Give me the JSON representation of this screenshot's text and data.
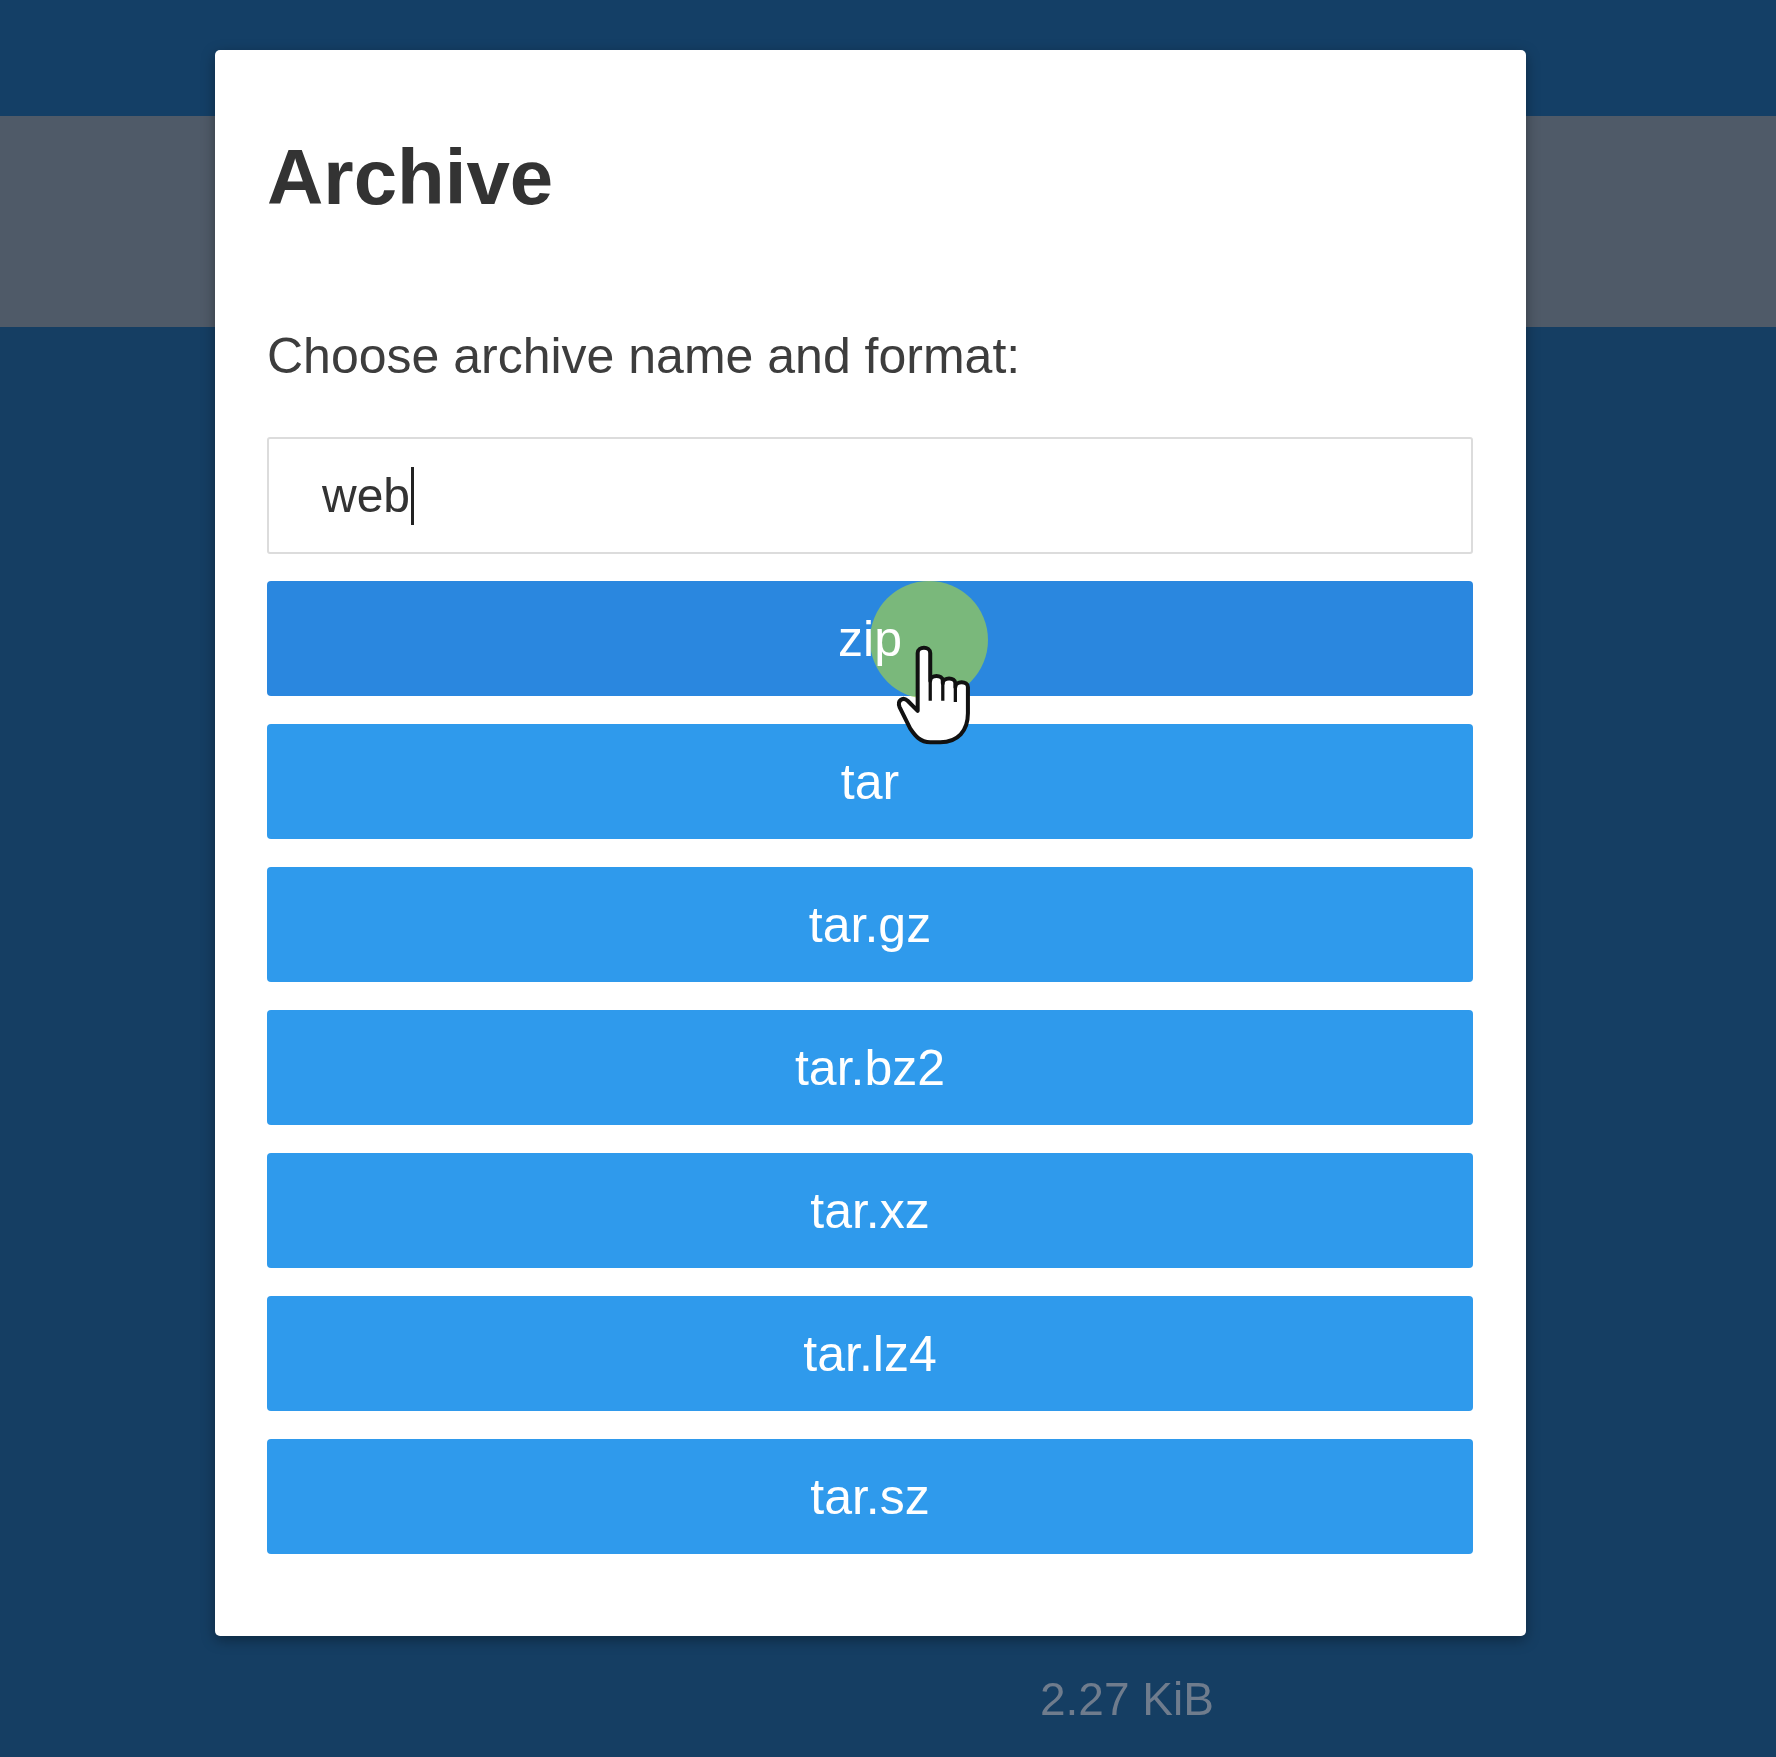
{
  "dialog": {
    "title": "Archive",
    "prompt": "Choose archive name and format:",
    "name_field": {
      "value": "web",
      "focused": true
    },
    "formats": [
      {
        "label": "zip",
        "hovered": true
      },
      {
        "label": "tar",
        "hovered": false
      },
      {
        "label": "tar.gz",
        "hovered": false
      },
      {
        "label": "tar.bz2",
        "hovered": false
      },
      {
        "label": "tar.xz",
        "hovered": false
      },
      {
        "label": "tar.lz4",
        "hovered": false
      },
      {
        "label": "tar.sz",
        "hovered": false
      }
    ]
  },
  "background": {
    "size_text": "2.27 KiB"
  }
}
